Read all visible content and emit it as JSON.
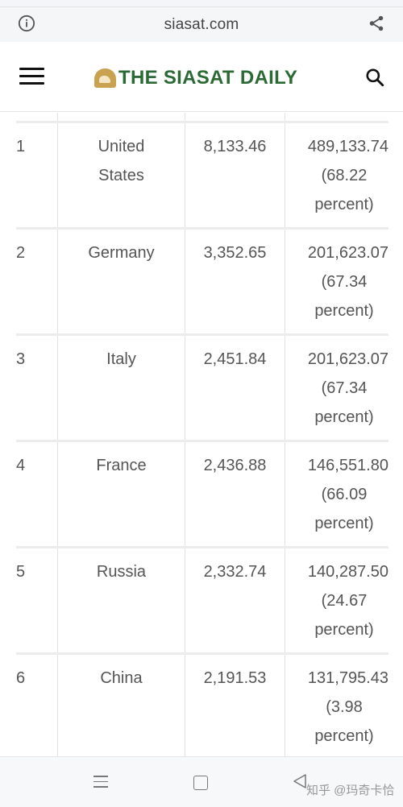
{
  "browser": {
    "url": "siasat.com",
    "icons": {
      "info": "info-icon",
      "share": "share-icon"
    }
  },
  "site": {
    "logo_text": "THE SIASAT DAILY",
    "brand_color": "#2b6a34",
    "logo_mark_color": "#c9a24f",
    "icons": {
      "menu": "hamburger-menu-icon",
      "search": "search-icon"
    }
  },
  "table": {
    "rows": [
      {
        "rank": "1",
        "country_line1": "United",
        "country_line2": "States",
        "cases": "8,133.46",
        "total": "489,133.74",
        "pct_line1": "(68.22",
        "pct_line2": "percent)"
      },
      {
        "rank": "2",
        "country_line1": "Germany",
        "country_line2": "",
        "cases": "3,352.65",
        "total": "201,623.07",
        "pct_line1": "(67.34",
        "pct_line2": "percent)"
      },
      {
        "rank": "3",
        "country_line1": "Italy",
        "country_line2": "",
        "cases": "2,451.84",
        "total": "201,623.07",
        "pct_line1": "(67.34",
        "pct_line2": "percent)"
      },
      {
        "rank": "4",
        "country_line1": "France",
        "country_line2": "",
        "cases": "2,436.88",
        "total": "146,551.80",
        "pct_line1": "(66.09",
        "pct_line2": "percent)"
      },
      {
        "rank": "5",
        "country_line1": "Russia",
        "country_line2": "",
        "cases": "2,332.74",
        "total": "140,287.50",
        "pct_line1": "(24.67",
        "pct_line2": "percent)"
      },
      {
        "rank": "6",
        "country_line1": "China",
        "country_line2": "",
        "cases": "2,191.53",
        "total": "131,795.43",
        "pct_line1": "(3.98",
        "pct_line2": "percent)"
      }
    ]
  },
  "navbar": {
    "icons": {
      "menu": "recent-apps-icon",
      "home": "home-icon",
      "back": "back-icon"
    },
    "watermark": "知乎 @玛奇卡恰"
  }
}
